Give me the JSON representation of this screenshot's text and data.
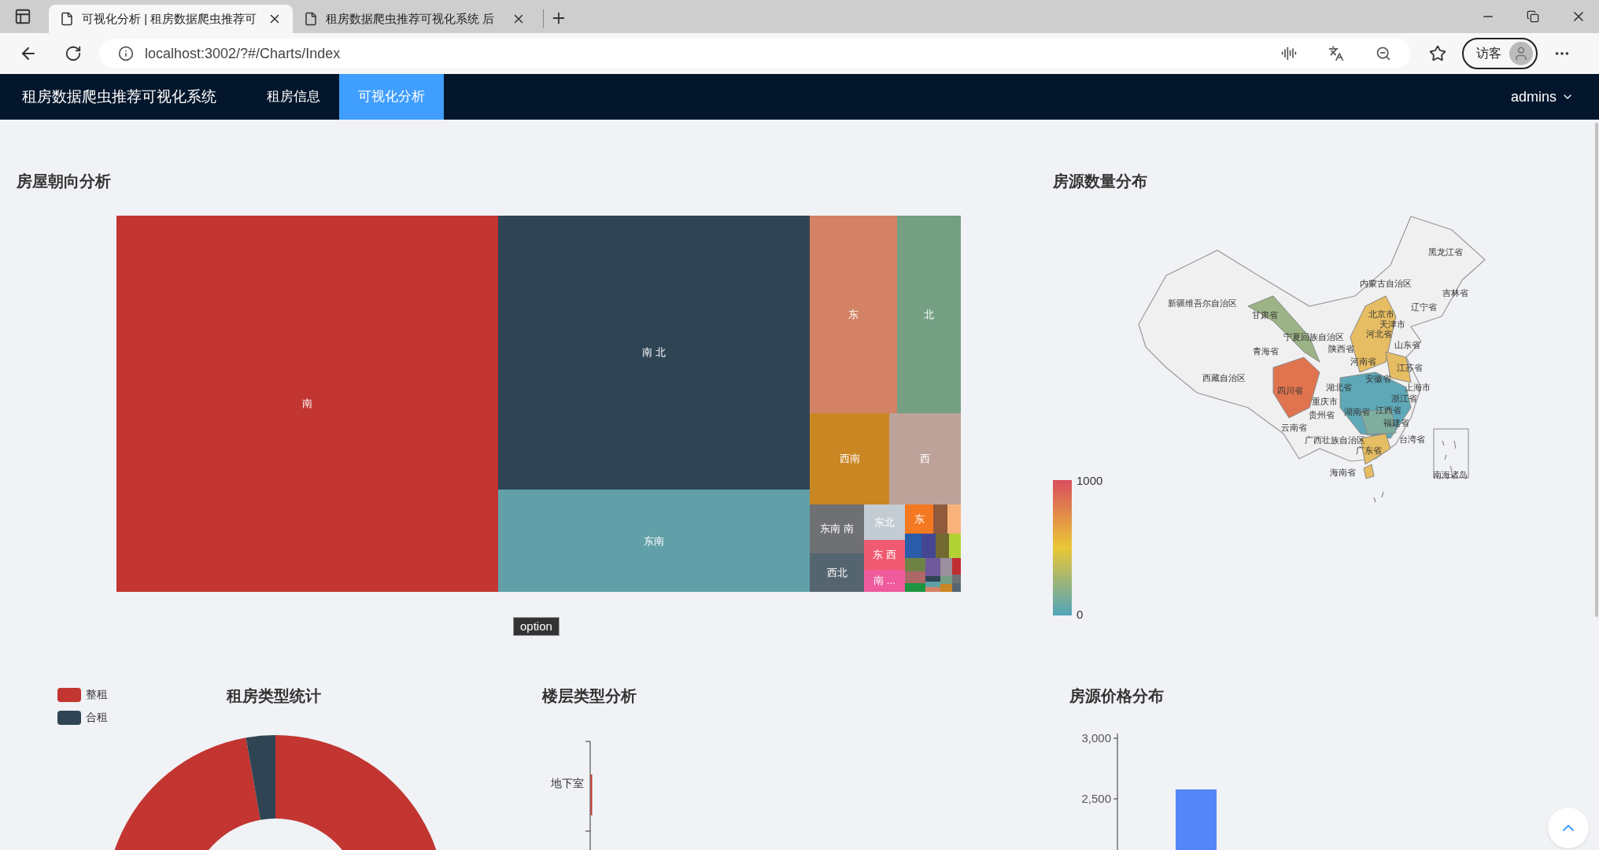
{
  "browser": {
    "tabs": [
      {
        "title": "可视化分析 | 租房数据爬虫推荐可",
        "selected": true
      },
      {
        "title": "租房数据爬虫推荐可视化系统 后",
        "selected": false
      }
    ],
    "url": "localhost:3002/?#/Charts/Index",
    "profile_label": "访客"
  },
  "navbar": {
    "brand": "租房数据爬虫推荐可视化系统",
    "items": [
      {
        "label": "租房信息",
        "selected": false
      },
      {
        "label": "可视化分析",
        "selected": true
      }
    ],
    "user": "admins"
  },
  "orientation_panel": {
    "title": "房屋朝向分析",
    "tooltip": "option",
    "cells": [
      {
        "label": "南",
        "color": "#c23531"
      },
      {
        "label": "南 北",
        "color": "#2f4554"
      },
      {
        "label": "东南",
        "color": "#61a0a8"
      },
      {
        "label": "东",
        "color": "#d48265"
      },
      {
        "label": "北",
        "color": "#749f83"
      },
      {
        "label": "西南",
        "color": "#ca8622"
      },
      {
        "label": "西",
        "color": "#bda29a"
      },
      {
        "label": "东南 南",
        "color": "#6e7074"
      },
      {
        "label": "西北",
        "color": "#546570"
      },
      {
        "label": "东北",
        "color": "#c4ccd3"
      },
      {
        "label": "东 西",
        "color": "#f05b72"
      },
      {
        "label": "南 ...",
        "color": "#ef5b9c"
      },
      {
        "label": "东",
        "color": "#f47920"
      },
      {
        "color": "#905a3d"
      },
      {
        "color": "#fab27b"
      },
      {
        "color": "#2a5caa"
      },
      {
        "color": "#444693"
      },
      {
        "color": "#726930"
      },
      {
        "color": "#b2d235"
      },
      {
        "color": "#6d8346"
      },
      {
        "color": "#6f599c"
      },
      {
        "color": "#9a8f9c"
      },
      {
        "color": "#c12e34"
      },
      {
        "color": "#ac6767"
      },
      {
        "color": "#1d953f"
      },
      {
        "color": "#2f4554"
      },
      {
        "color": "#61a0a8"
      },
      {
        "color": "#d48265"
      },
      {
        "color": "#749f83"
      },
      {
        "color": "#ca8622"
      },
      {
        "color": "#6e7074"
      },
      {
        "color": "#546570"
      }
    ]
  },
  "map_panel": {
    "title": "房源数量分布",
    "regions": [
      "黑龙江省",
      "内蒙古自治区",
      "吉林省",
      "新疆维吾尔自治区",
      "辽宁省",
      "甘肃省",
      "北京市",
      "天津市",
      "河北省",
      "宁夏回族自治区",
      "青海省",
      "陕西省",
      "山东省",
      "河南省",
      "江苏省",
      "安徽省",
      "西藏自治区",
      "四川省",
      "湖北省",
      "上海市",
      "重庆市",
      "浙江省",
      "贵州省",
      "湖南省",
      "江西省",
      "福建省",
      "云南省",
      "广西壮族自治区",
      "台湾省",
      "广东省",
      "海南省",
      "南海诸岛"
    ],
    "legend": {
      "max": "1000",
      "min": "0"
    }
  },
  "rent_type_panel": {
    "title": "租房类型统计",
    "legend": [
      {
        "label": "整租",
        "color": "#c23531"
      },
      {
        "label": "合租",
        "color": "#2f4554"
      }
    ]
  },
  "floor_panel": {
    "title": "楼层类型分析",
    "categories": [
      "地下室"
    ]
  },
  "price_panel": {
    "title": "房源价格分布",
    "tick_labels": [
      "3,000",
      "2,500"
    ]
  }
}
